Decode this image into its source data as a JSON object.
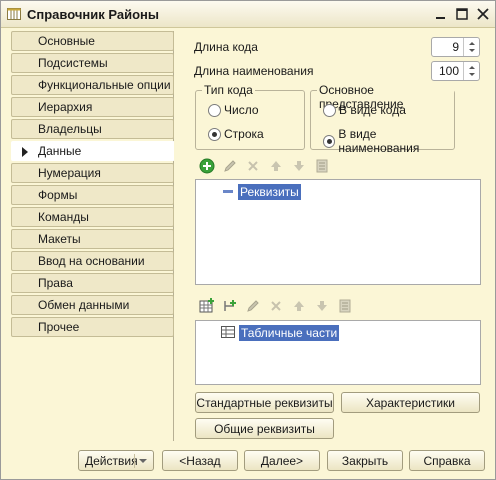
{
  "window": {
    "title": "Справочник Районы",
    "controls": [
      "minimize",
      "maximize",
      "close"
    ]
  },
  "tabs": [
    {
      "label": "Основные",
      "active": false
    },
    {
      "label": "Подсистемы",
      "active": false
    },
    {
      "label": "Функциональные опции",
      "active": false
    },
    {
      "label": "Иерархия",
      "active": false
    },
    {
      "label": "Владельцы",
      "active": false
    },
    {
      "label": "Данные",
      "active": true
    },
    {
      "label": "Нумерация",
      "active": false
    },
    {
      "label": "Формы",
      "active": false
    },
    {
      "label": "Команды",
      "active": false
    },
    {
      "label": "Макеты",
      "active": false
    },
    {
      "label": "Ввод на основании",
      "active": false
    },
    {
      "label": "Права",
      "active": false
    },
    {
      "label": "Обмен данными",
      "active": false
    },
    {
      "label": "Прочее",
      "active": false
    }
  ],
  "data_tab": {
    "code_length": {
      "label": "Длина кода",
      "value": "9"
    },
    "name_length": {
      "label": "Длина наименования",
      "value": "100"
    },
    "code_type": {
      "title": "Тип кода",
      "options": [
        {
          "label": "Число",
          "selected": false
        },
        {
          "label": "Строка",
          "selected": true
        }
      ]
    },
    "main_presentation": {
      "title": "Основное представление",
      "options": [
        {
          "label": "В виде кода",
          "selected": false
        },
        {
          "label": "В виде наименования",
          "selected": true
        }
      ]
    },
    "attributes_tree": {
      "root_label": "Реквизиты"
    },
    "tabular_tree": {
      "root_label": "Табличные части"
    },
    "buttons": {
      "standard_attributes": "Стандартные реквизиты",
      "characteristics": "Характеристики",
      "common_attributes": "Общие реквизиты"
    }
  },
  "footer": {
    "actions": "Действия",
    "back": "<Назад",
    "next": "Далее>",
    "close": "Закрыть",
    "help": "Справка"
  },
  "colors": {
    "window_bg": "#fbf6d6",
    "selection": "#4a6fbd",
    "add_green": "#3aa23a",
    "delete_red": "#d04a3a"
  }
}
